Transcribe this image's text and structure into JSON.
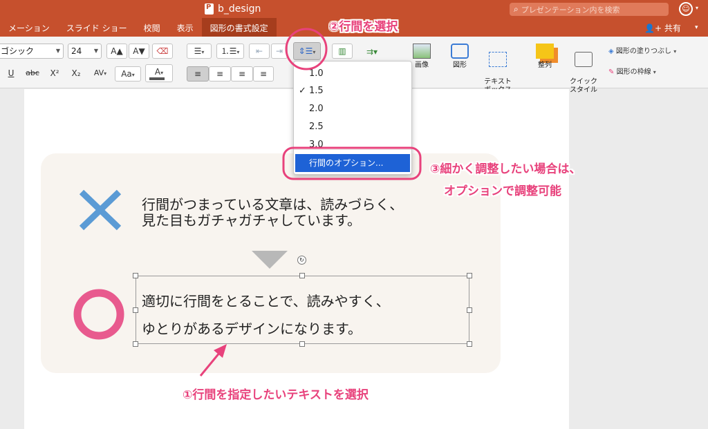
{
  "window": {
    "doc_title": "b_design",
    "search_placeholder": "プレゼンテーション内を検索"
  },
  "tabs": [
    {
      "label": "メーション"
    },
    {
      "label": "スライド ショー"
    },
    {
      "label": "校閲"
    },
    {
      "label": "表示"
    },
    {
      "label": "図形の書式設定",
      "active": true
    }
  ],
  "share_label": "共有",
  "ribbon": {
    "font_name": "ゴシック",
    "font_size": "24",
    "underline": "U",
    "strike": "abc",
    "superscript": "X²",
    "subscript": "X₂",
    "spacing": "AV",
    "case": "Aa",
    "font_color": "A",
    "grow": "A▲",
    "shrink": "A▼",
    "image_label": "画像",
    "shape_label": "図形",
    "textbox_label": "テキスト\nボックス",
    "arrange_label": "整列",
    "quick_style_label": "クイック\nスタイル",
    "fill_label": "図形の塗りつぶし",
    "outline_label": "図形の枠線"
  },
  "dropdown": {
    "items": [
      {
        "label": "1.0",
        "checked": false
      },
      {
        "label": "1.5",
        "checked": true
      },
      {
        "label": "2.0",
        "checked": false
      },
      {
        "label": "2.5",
        "checked": false
      },
      {
        "label": "3.0",
        "checked": false
      }
    ],
    "options_label": "行間のオプション..."
  },
  "slide": {
    "bad_line1": "行間がつまっている文章は、読みづらく、",
    "bad_line2": "見た目もガチャガチャしています。",
    "good_line1": "適切に行間をとることで、読みやすく、",
    "good_line2": "ゆとりがあるデザインになります。"
  },
  "annotations": {
    "step1": "①行間を指定したいテキストを選択",
    "step2": "②行間を選択",
    "step3_line1": "③細かく調整したい場合は、",
    "step3_line2": "オプションで調整可能"
  },
  "colors": {
    "title_bar": "#c6502d",
    "accent_pink": "#e8427c",
    "cross_blue": "#5b9bd5",
    "circle_pink": "#e85a8e",
    "menu_highlight": "#1e62d6"
  }
}
